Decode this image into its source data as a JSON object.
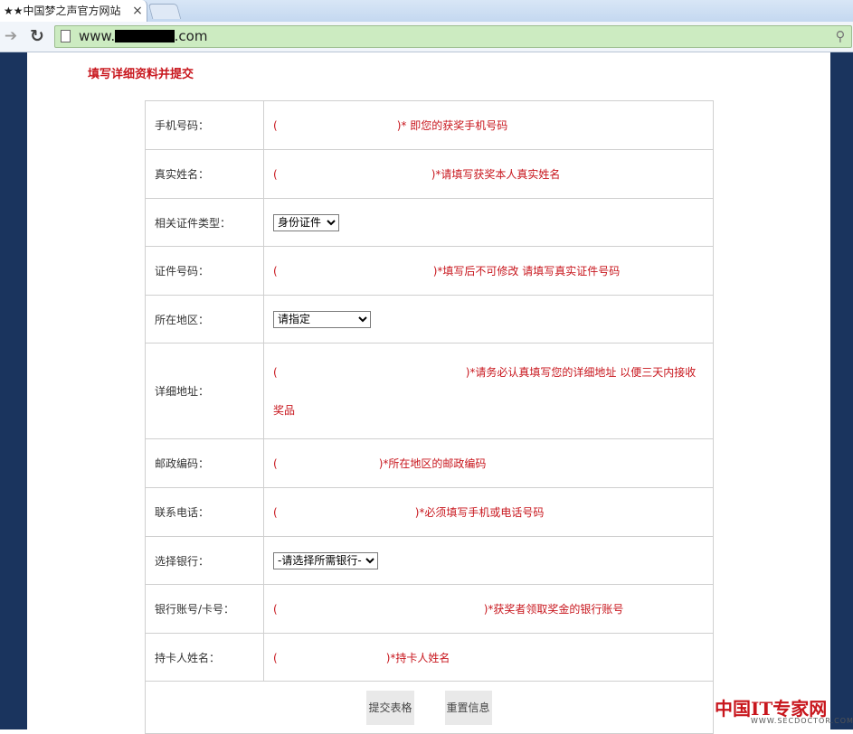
{
  "browser": {
    "tab_title": "★★中国梦之声官方网站",
    "url_prefix": "www.",
    "url_masked": "●●●●●",
    "url_suffix": ".com"
  },
  "form": {
    "title": "填写详细资料并提交",
    "rows": [
      {
        "label": "手机号码：",
        "open": "(",
        "close": ")",
        "hint": "* 即您的获奖手机号码"
      },
      {
        "label": "真实姓名：",
        "open": "(",
        "close": ")",
        "hint": "*请填写获奖本人真实姓名"
      },
      {
        "label": "相关证件类型：",
        "select": "身份证件"
      },
      {
        "label": "证件号码：",
        "open": "(",
        "close": ")",
        "hint": "*填写后不可修改 请填写真实证件号码"
      },
      {
        "label": "所在地区：",
        "select": "请指定"
      },
      {
        "label": "详细地址：",
        "open": "(",
        "close": ")",
        "hint": "*请务必认真填写您的详细地址 以便三天内接收奖品"
      },
      {
        "label": "邮政编码：",
        "open": "(",
        "close": ")",
        "hint": "*所在地区的邮政编码"
      },
      {
        "label": "联系电话：",
        "open": "(",
        "close": ")",
        "hint": "*必须填写手机或电话号码"
      },
      {
        "label": "选择银行：",
        "select": "-请选择所需银行-"
      },
      {
        "label": "银行账号/卡号：",
        "open": "(",
        "close": ")",
        "hint": "*获奖者领取奖金的银行账号"
      },
      {
        "label": "持卡人姓名：",
        "open": "(",
        "close": ")",
        "hint": "*持卡人姓名"
      }
    ],
    "submit_label": "提交表格",
    "reset_label": "重置信息"
  },
  "watermark": {
    "main": "中国IT专家网",
    "sub": "WWW.SECDOCTOR.COM"
  },
  "colors": {
    "accent_red": "#c8161d",
    "page_side": "#1a345e",
    "omnibox": "#ccebc1"
  }
}
